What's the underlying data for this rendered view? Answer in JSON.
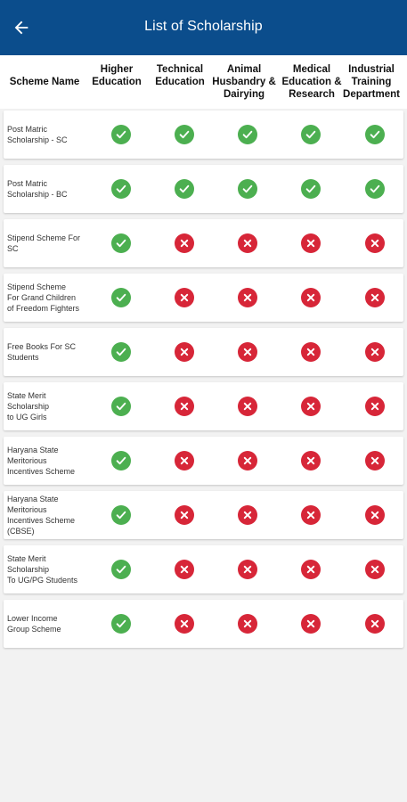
{
  "app": {
    "title": "List of Scholarship"
  },
  "table": {
    "headers": {
      "scheme": "Scheme Name",
      "columns": [
        "Higher\nEducation",
        "Technical\nEducation",
        "Animal\nHusbandry &\nDairying",
        "Medical\nEducation &\nResearch",
        "Industrial\nTraining\nDepartment"
      ]
    },
    "rows": [
      {
        "name": "Post Matric\nScholarship - SC",
        "status": [
          true,
          true,
          true,
          true,
          true
        ]
      },
      {
        "name": "Post Matric\nScholarship - BC",
        "status": [
          true,
          true,
          true,
          true,
          true
        ]
      },
      {
        "name": "Stipend Scheme For\nSC",
        "status": [
          true,
          false,
          false,
          false,
          false
        ]
      },
      {
        "name": "Stipend Scheme\n For Grand Children\nof Freedom Fighters",
        "status": [
          true,
          false,
          false,
          false,
          false
        ]
      },
      {
        "name": "Free Books For SC\nStudents",
        "status": [
          true,
          false,
          false,
          false,
          false
        ]
      },
      {
        "name": "State Merit\nScholarship\n to UG Girls",
        "status": [
          true,
          false,
          false,
          false,
          false
        ]
      },
      {
        "name": "Haryana State\nMeritorious\n Incentives Scheme",
        "status": [
          true,
          false,
          false,
          false,
          false
        ]
      },
      {
        "name": "Haryana State\nMeritorious\n Incentives Scheme\n(CBSE)",
        "status": [
          true,
          false,
          false,
          false,
          false
        ]
      },
      {
        "name": "State Merit\nScholarship\n To UG/PG Students",
        "status": [
          true,
          false,
          false,
          false,
          false
        ]
      },
      {
        "name": "Lower Income\n Group Scheme",
        "status": [
          true,
          false,
          false,
          false,
          false
        ]
      }
    ]
  },
  "icons": {
    "back": "arrow-left-icon",
    "yes": "check-circle-icon",
    "no": "cross-circle-icon"
  },
  "colors": {
    "appbar": "#0b4d8c",
    "yes": "#4caf50",
    "no": "#d72638"
  }
}
